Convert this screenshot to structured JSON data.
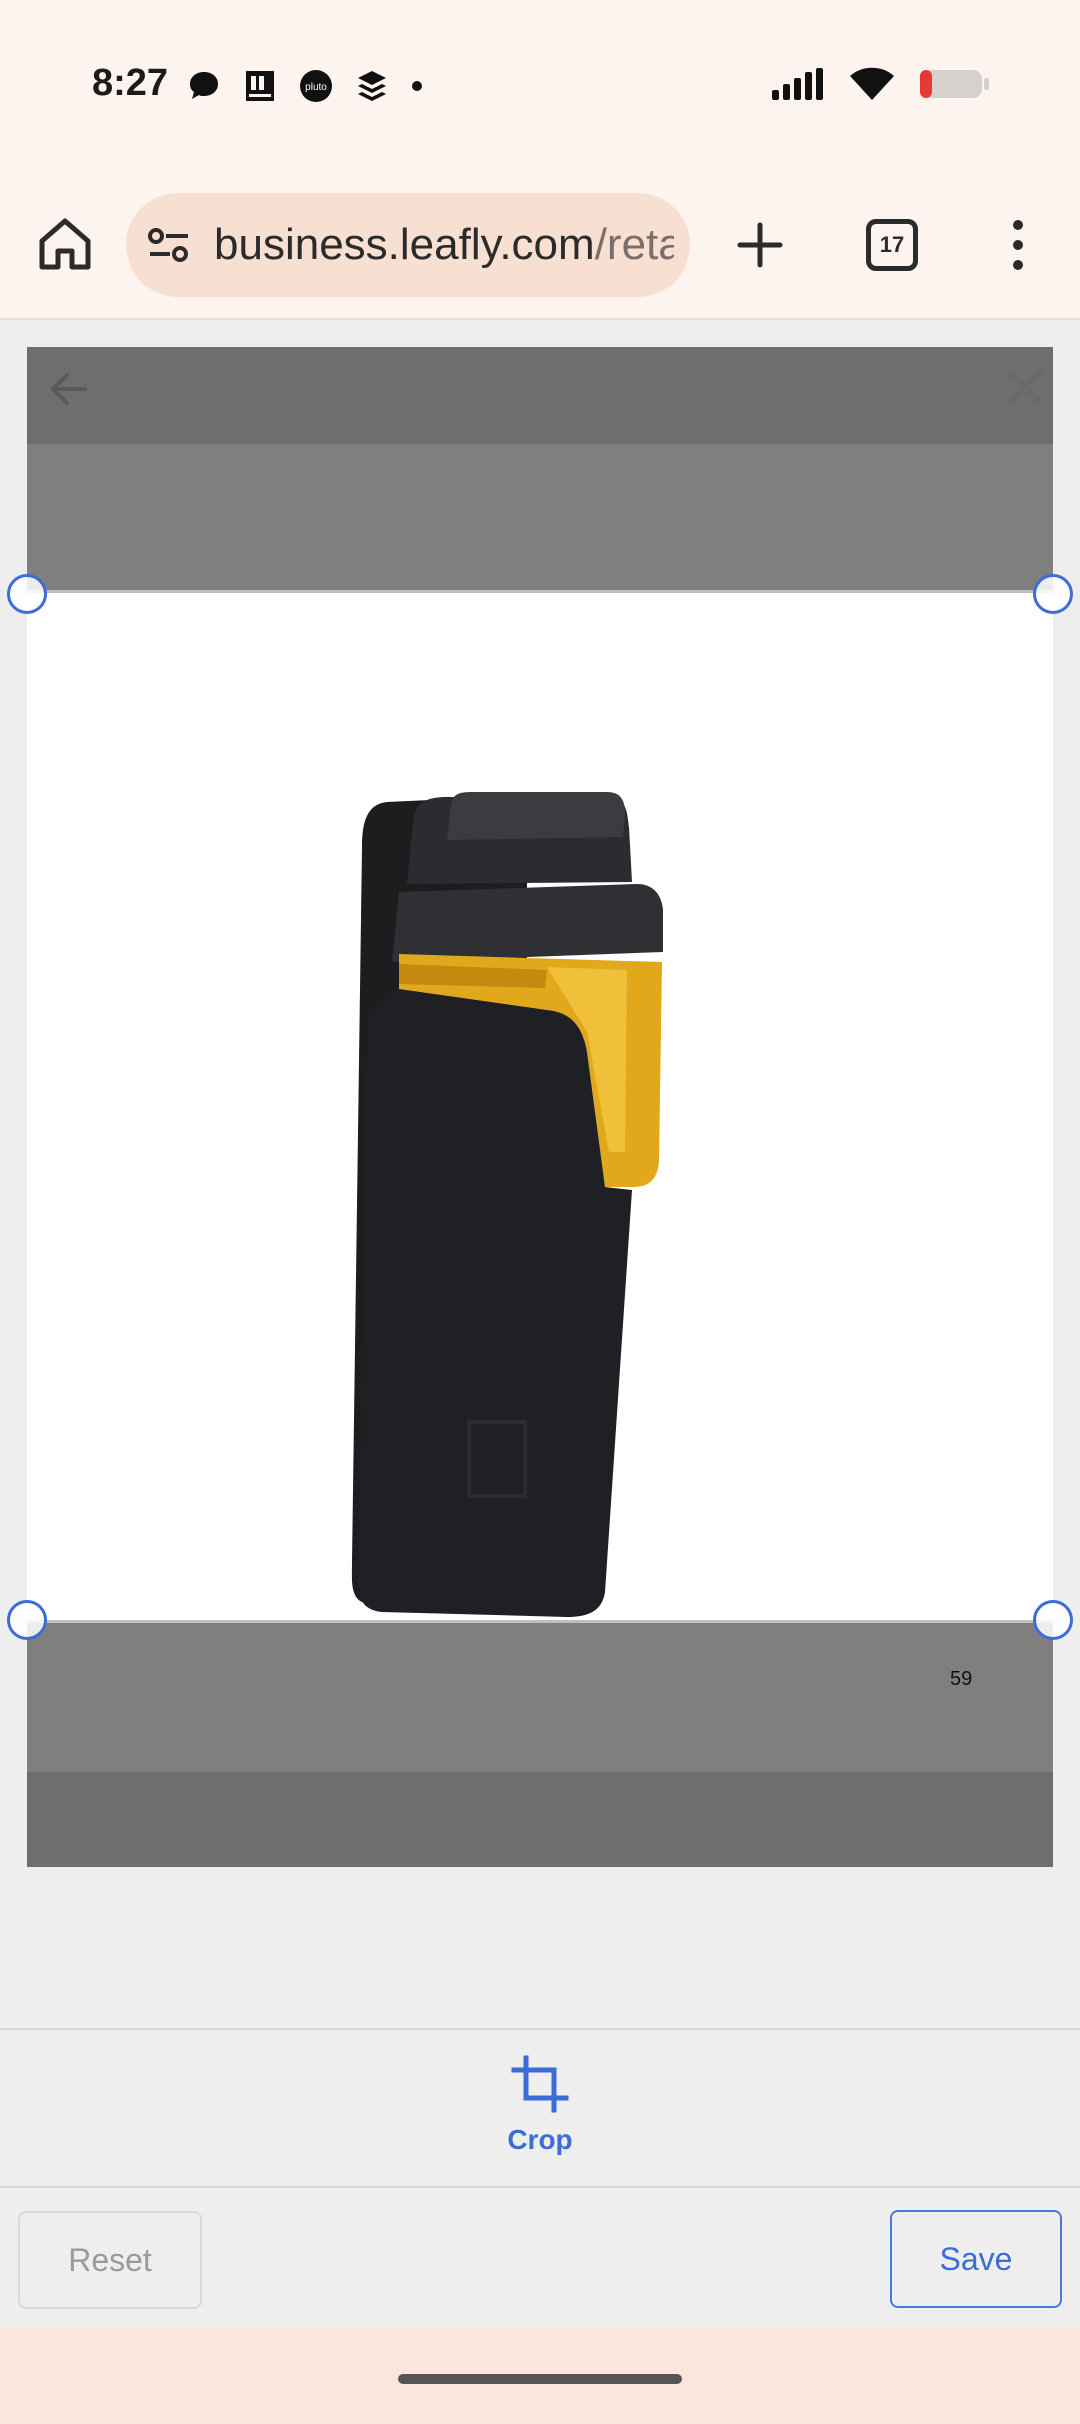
{
  "status_bar": {
    "time": "8:27",
    "notification_icons": [
      "threads-icon",
      "calendar-icon",
      "pluto-tv-icon",
      "stack-icon",
      "dot-icon"
    ],
    "system_icons": [
      "signal-icon",
      "wifi-icon",
      "battery-icon"
    ],
    "battery_color": "#e53935"
  },
  "browser": {
    "url_main": "business.leafly.com",
    "url_rest": "/reta",
    "tab_count": "17"
  },
  "editor": {
    "image_label": "59",
    "product": "black vape device with amber cartridge window"
  },
  "toolbar": {
    "crop_label": "Crop",
    "accent": "#3b6cd8"
  },
  "actions": {
    "reset_label": "Reset",
    "save_label": "Save"
  }
}
